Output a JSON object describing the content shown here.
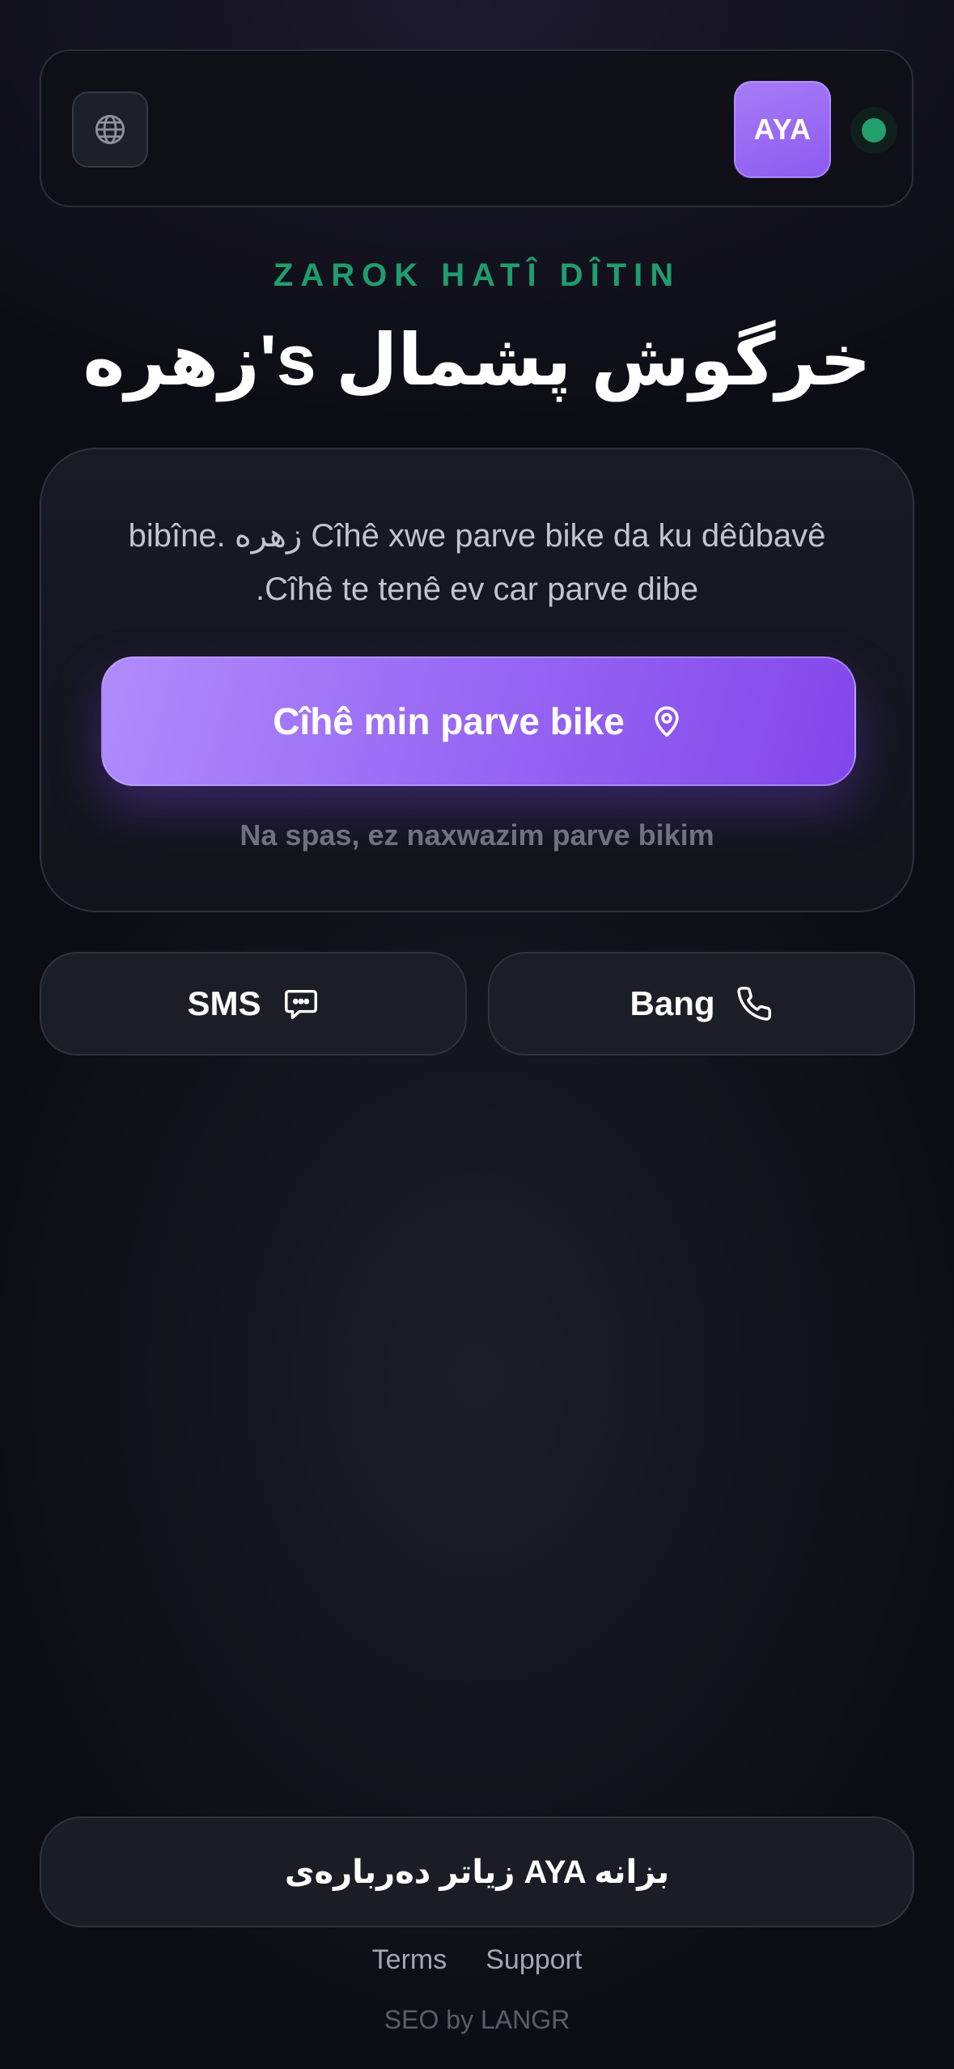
{
  "header": {
    "language_icon": "globe-icon",
    "logo_text": "AYA",
    "status": "online",
    "status_color": "#22a06b"
  },
  "hero": {
    "eyebrow": "ZAROK HATÎ DÎTIN",
    "title": "زهره's خرگوش پشمال"
  },
  "card": {
    "description": "bibîne. زهره Cîhê xwe parve bike da ku dêûbavê .Cîhê te tenê ev car parve dibe",
    "share_button_label": "Cîhê min parve bike",
    "share_button_icon": "map-pin-icon",
    "decline_label": "Na spas, ez naxwazim parve bikim"
  },
  "actions": {
    "sms_label": "SMS",
    "sms_icon": "message-icon",
    "call_label": "Bang",
    "call_icon": "phone-icon"
  },
  "footer": {
    "learn_more_label": "زیاتر دەربارەی AYA بزانە",
    "terms_label": "Terms",
    "support_label": "Support",
    "seo_credit": "SEO by LANGR"
  },
  "colors": {
    "background": "#0c0d14",
    "accent_purple": "#9a6af5",
    "accent_green": "#1f9d6e"
  }
}
